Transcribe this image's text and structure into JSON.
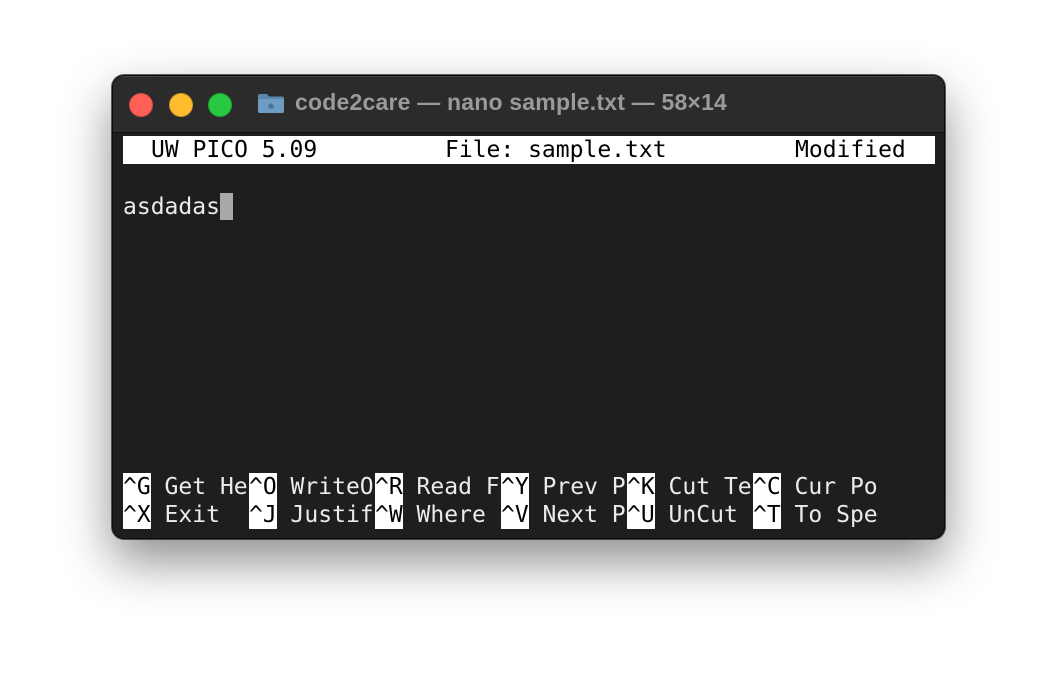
{
  "window": {
    "title": "code2care — nano sample.txt — 58×14",
    "folder_icon": "folder-icon"
  },
  "editor": {
    "version": "UW PICO 5.09",
    "file_label": "File: sample.txt",
    "status": "Modified",
    "content": "asdadas"
  },
  "shortcuts": {
    "row1": [
      {
        "key": "^G",
        "label": " Get He"
      },
      {
        "key": "^O",
        "label": " WriteO"
      },
      {
        "key": "^R",
        "label": " Read F"
      },
      {
        "key": "^Y",
        "label": " Prev P"
      },
      {
        "key": "^K",
        "label": " Cut Te"
      },
      {
        "key": "^C",
        "label": " Cur Po"
      }
    ],
    "row2": [
      {
        "key": "^X",
        "label": " Exit  "
      },
      {
        "key": "^J",
        "label": " Justif"
      },
      {
        "key": "^W",
        "label": " Where "
      },
      {
        "key": "^V",
        "label": " Next P"
      },
      {
        "key": "^U",
        "label": " UnCut "
      },
      {
        "key": "^T",
        "label": " To Spe"
      }
    ]
  },
  "colors": {
    "close": "#ff5f57",
    "minimize": "#febc2e",
    "maximize": "#28c840",
    "terminal_bg": "#1e1e1e",
    "titlebar_bg": "#2b2b2b"
  }
}
